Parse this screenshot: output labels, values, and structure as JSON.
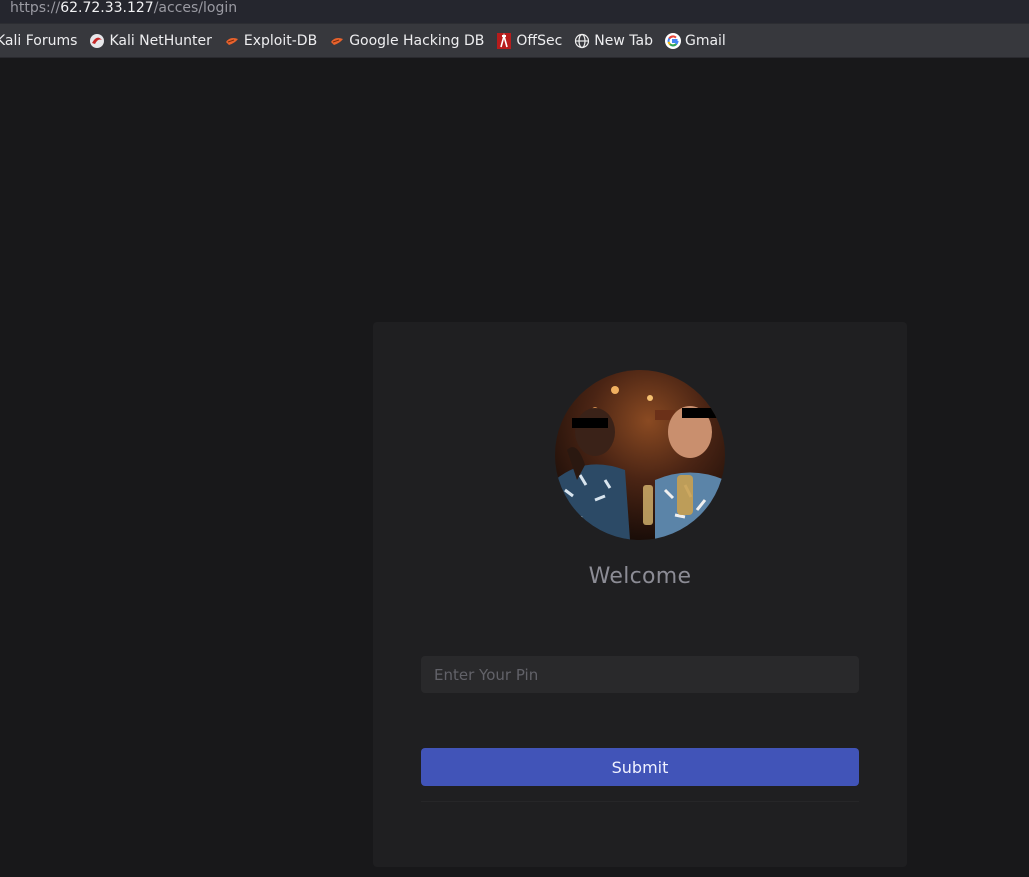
{
  "browser": {
    "url_scheme": "https://",
    "url_host": "62.72.33.127",
    "url_path": "/acces/login",
    "bookmarks": [
      {
        "label": "Kali Forums",
        "icon": "kali-dragon-icon"
      },
      {
        "label": "Kali NetHunter",
        "icon": "nethunter-icon"
      },
      {
        "label": "Exploit-DB",
        "icon": "exploit-db-icon"
      },
      {
        "label": "Google Hacking DB",
        "icon": "exploit-db-icon"
      },
      {
        "label": "OffSec",
        "icon": "offsec-icon"
      },
      {
        "label": "New Tab",
        "icon": "globe-icon"
      },
      {
        "label": "Gmail",
        "icon": "google-icon"
      }
    ]
  },
  "login": {
    "welcome": "Welcome",
    "pin_placeholder": "Enter Your Pin",
    "pin_value": "",
    "submit_label": "Submit"
  },
  "colors": {
    "page_bg": "#18181a",
    "card_bg": "#1f1f21",
    "button": "#4154b8"
  }
}
